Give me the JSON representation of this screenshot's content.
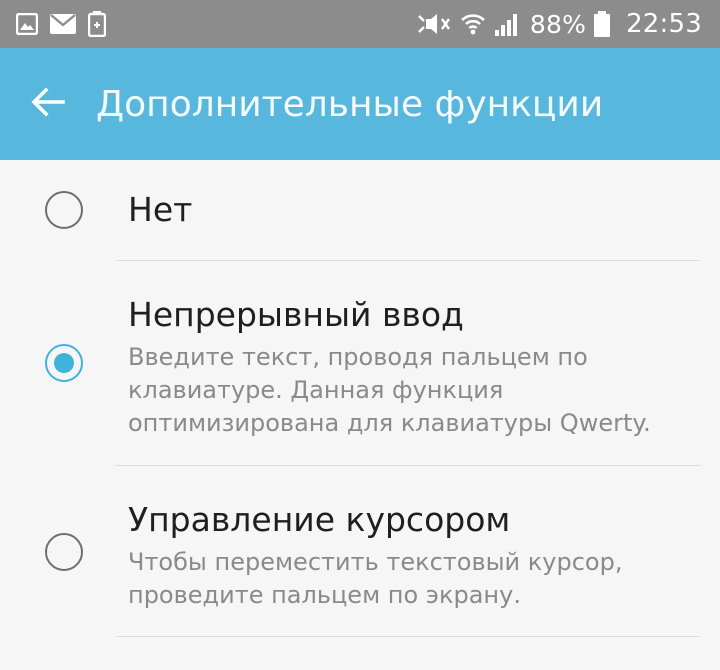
{
  "status_bar": {
    "left_icons": [
      "image-icon",
      "mail-icon",
      "battery-saver-icon"
    ],
    "right_icons": [
      "mute-icon",
      "wifi-icon",
      "signal-icon",
      "battery-icon"
    ],
    "battery": "88%",
    "time": "22:53"
  },
  "app_bar": {
    "back_icon": "arrow-back-icon",
    "title": "Дополнительные функции",
    "color": "#58b7dc"
  },
  "options": [
    {
      "title": "Нет",
      "description": "",
      "selected": false
    },
    {
      "title": "Непрерывный ввод",
      "description": "Введите текст, проводя пальцем по клавиатуре. Данная функция оптимизирована для клавиатуры Qwerty.",
      "selected": true
    },
    {
      "title": "Управление курсором",
      "description": "Чтобы переместить текстовый курсор, проведите пальцем по экрану.",
      "selected": false
    }
  ],
  "accent_color": "#3fb4db"
}
